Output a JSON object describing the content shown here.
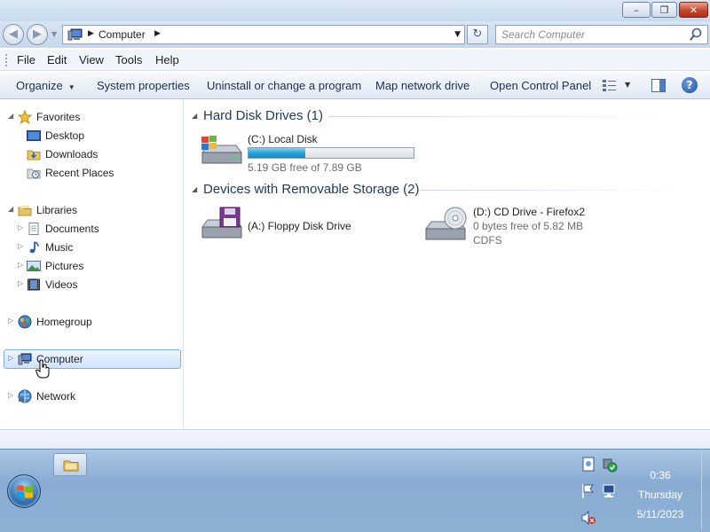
{
  "window": {
    "minimize_glyph": "–",
    "restore_glyph": "❐",
    "close_glyph": "✕"
  },
  "address": {
    "crumb": "Computer",
    "search_placeholder": "Search Computer"
  },
  "menu": {
    "items": [
      "File",
      "Edit",
      "View",
      "Tools",
      "Help"
    ]
  },
  "commands": {
    "organize": "Organize",
    "system_properties": "System properties",
    "uninstall": "Uninstall or change a program",
    "map_drive": "Map network drive",
    "control_panel": "Open Control Panel",
    "help_glyph": "?"
  },
  "nav": {
    "favorites": "Favorites",
    "desktop": "Desktop",
    "downloads": "Downloads",
    "recent": "Recent Places",
    "libraries": "Libraries",
    "documents": "Documents",
    "music": "Music",
    "pictures": "Pictures",
    "videos": "Videos",
    "homegroup": "Homegroup",
    "computer": "Computer",
    "network": "Network"
  },
  "content": {
    "hdd_group": "Hard Disk Drives (1)",
    "removable_group": "Devices with Removable Storage (2)",
    "c_drive": {
      "name": "(C:) Local Disk",
      "free": "5.19 GB free of 7.89 GB",
      "used_fraction": 0.342
    },
    "a_drive": {
      "name": "(A:) Floppy Disk Drive"
    },
    "d_drive": {
      "name": "(D:) CD Drive - Firefox2",
      "free": "0 bytes free of 5.82 MB",
      "fs": "CDFS"
    }
  },
  "taskbar": {
    "time": "0:36",
    "day": "Thursday",
    "date": "5/11/2023"
  },
  "colors": {
    "accent": "#26a0da",
    "selection": "#cfe3fc"
  }
}
